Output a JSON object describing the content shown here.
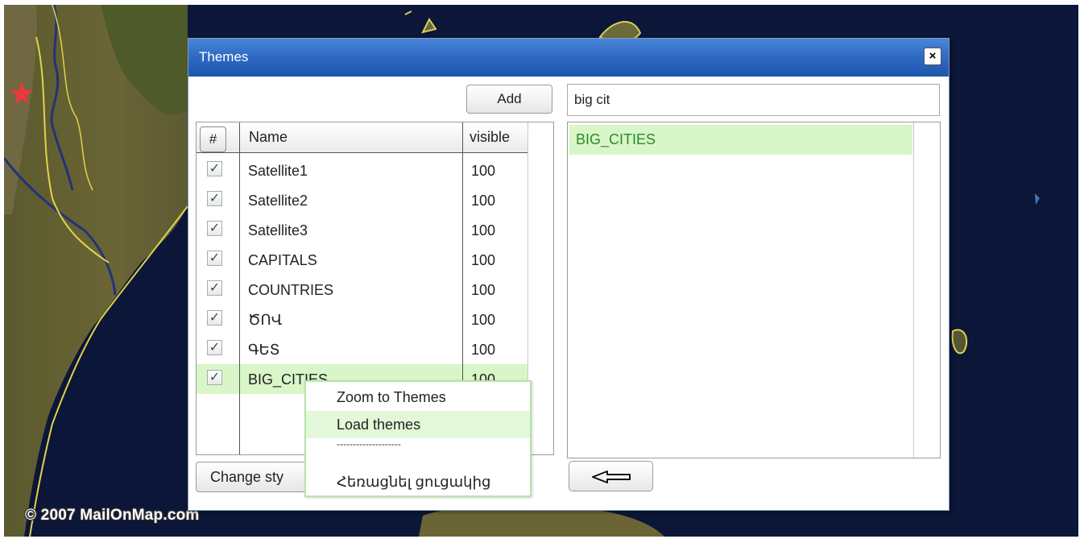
{
  "map": {
    "copyright": "© 2007 MailOnMap.com"
  },
  "dialog": {
    "title": "Themes",
    "close_label": "×",
    "add_label": "Add",
    "search_value": "big cit",
    "grid": {
      "hash_label": "#",
      "col_name": "Name",
      "col_visible": "visible",
      "rows": [
        {
          "checked": true,
          "name": "Satellite1",
          "visible": "100"
        },
        {
          "checked": true,
          "name": "Satellite2",
          "visible": "100"
        },
        {
          "checked": true,
          "name": "Satellite3",
          "visible": "100"
        },
        {
          "checked": true,
          "name": "CAPITALS",
          "visible": "100"
        },
        {
          "checked": true,
          "name": "COUNTRIES",
          "visible": "100"
        },
        {
          "checked": true,
          "name": "ԾՈՎ",
          "visible": "100"
        },
        {
          "checked": true,
          "name": "ԳԵՏ",
          "visible": "100"
        },
        {
          "checked": true,
          "name": "BIG_CITIES",
          "visible": "100"
        }
      ],
      "selected_row": 7
    },
    "change_style_label": "Change sty",
    "results": [
      "BIG_CITIES"
    ],
    "check_glyph": "✓"
  },
  "context_menu": {
    "items": [
      "Zoom to Themes",
      "Load themes",
      "Հեռացնել ցուցակից"
    ],
    "separator": "--------------------",
    "highlighted": 1
  },
  "colors": {
    "title_bar": "#2f6bc4",
    "selection": "#d8f6c8",
    "result_text": "#2b8a2b",
    "menu_border": "#b6e6a8"
  }
}
